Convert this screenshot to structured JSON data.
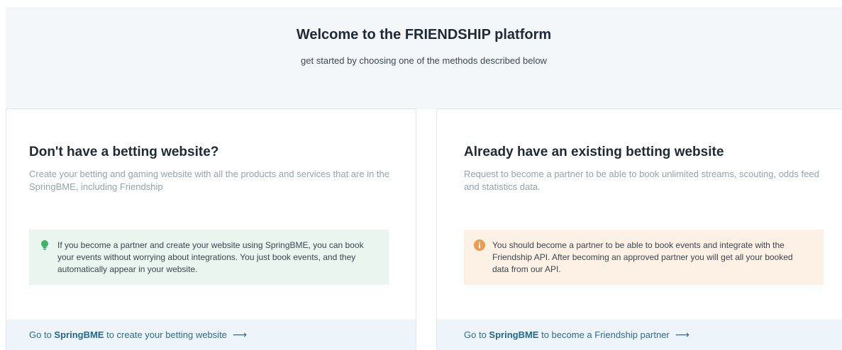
{
  "hero": {
    "title": "Welcome to the FRIENDSHIP platform",
    "subtitle": "get started by choosing one of the methods described below"
  },
  "cards": [
    {
      "title": "Don't have a betting website?",
      "description": "Create your betting and gaming website with all the products and services that are in the SpringBME, including Friendship",
      "callout_text": "If you become a partner and create your website using SpringBME, you can book your events without worrying about integrations. You just book events, and they automatically appear in your website.",
      "callout_icon": "lightbulb-icon",
      "callout_color": "#e9f5ee",
      "link_prefix": "Go to ",
      "link_brand": "SpringBME",
      "link_suffix": " to create your betting website",
      "link_arrow": "⟶"
    },
    {
      "title": "Already have an existing betting website",
      "description": "Request to become a partner to be able to book unlimited streams, scouting, odds feed and statistics data.",
      "callout_text": "You should become a partner to be able to book events and integrate with the Friendship API. After becoming an approved partner you will get all your booked data from our API.",
      "callout_icon": "info-icon",
      "callout_color": "#fdf0e5",
      "link_prefix": "Go to ",
      "link_brand": "SpringBME",
      "link_suffix": " to become a Friendship partner",
      "link_arrow": "⟶"
    }
  ],
  "colors": {
    "hero_bg": "#f3f7fa",
    "footer_bg": "#eef5fa",
    "link": "#2e6b93",
    "icon_green": "#3fb36b",
    "icon_orange": "#ef9a4e"
  }
}
